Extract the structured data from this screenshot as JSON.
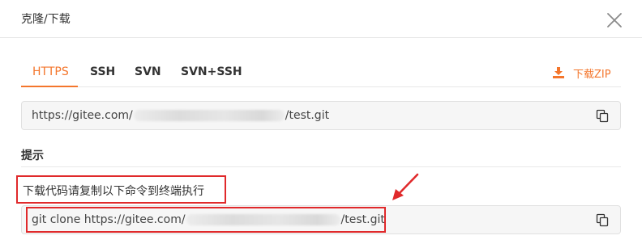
{
  "dialog": {
    "title": "克隆/下载"
  },
  "tabs": [
    {
      "label": "HTTPS",
      "active": true
    },
    {
      "label": "SSH",
      "active": false
    },
    {
      "label": "SVN",
      "active": false
    },
    {
      "label": "SVN+SSH",
      "active": false
    }
  ],
  "download_zip": {
    "label": "下载ZIP",
    "icon": "download-icon"
  },
  "url_field": {
    "prefix": "https://gitee.com/",
    "suffix": "/test.git"
  },
  "hint": {
    "label": "提示",
    "instruction": "下载代码请复制以下命令到终端执行"
  },
  "command_field": {
    "prefix": "git clone https://gitee.com/",
    "suffix": "/test.git"
  },
  "colors": {
    "accent": "#f4762c",
    "annotation_red": "#e0292b",
    "field_bg": "#f6f6f6"
  },
  "icons": {
    "close": "close-icon",
    "copy": "copy-icon",
    "arrow": "annotation-arrow"
  }
}
